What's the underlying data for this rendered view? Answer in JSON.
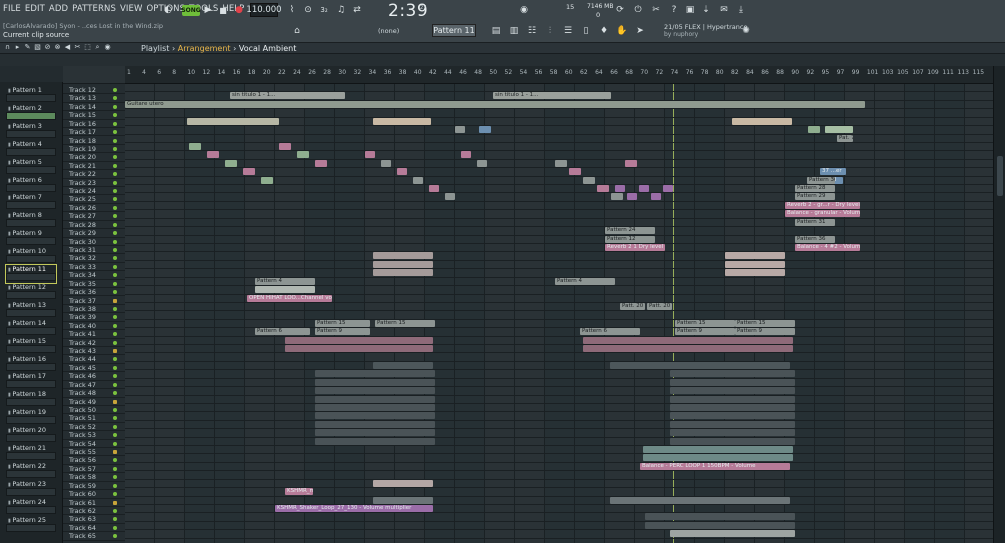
{
  "menu": [
    "FILE",
    "EDIT",
    "ADD",
    "PATTERNS",
    "VIEW",
    "OPTIONS",
    "TOOLS",
    "HELP"
  ],
  "hint": {
    "line1": "[CarlosAlvarado] Syon - ..ces Lost in the Wind.zip",
    "line2": "Current clip source"
  },
  "transport": {
    "mode": "SONG",
    "tempo": "110.000",
    "time": "2:39",
    "time_small": "27",
    "time_unit": "M:S:CS"
  },
  "cpu": {
    "value": "15",
    "memory": "7146 MB",
    "voices": "0"
  },
  "news": {
    "line1": "21/05  FLEX | Hypertrance",
    "line2": "by nuphory"
  },
  "pattern_selector": "Pattern 11",
  "snap": "(none)",
  "playlist": {
    "prefix": "Playlist",
    "sep": "›",
    "section": "Arrangement",
    "sep2": "›",
    "clip": "Vocal Ambient"
  },
  "picker": [
    "Pattern 1",
    "Pattern 2",
    "Pattern 3",
    "Pattern 4",
    "Pattern 5",
    "Pattern 6",
    "Pattern 7",
    "Pattern 8",
    "Pattern 9",
    "Pattern 10",
    "Pattern 11",
    "Pattern 12",
    "Pattern 13",
    "Pattern 14",
    "Pattern 15",
    "Pattern 16",
    "Pattern 17",
    "Pattern 18",
    "Pattern 19",
    "Pattern 20",
    "Pattern 21",
    "Pattern 22",
    "Pattern 23",
    "Pattern 24",
    "Pattern 25"
  ],
  "picker_selected": "Pattern 11",
  "tracks": [
    "Track 12",
    "Track 13",
    "Track 14",
    "Track 15",
    "Track 16",
    "Track 17",
    "Track 18",
    "Track 19",
    "Track 20",
    "Track 21",
    "Track 22",
    "Track 23",
    "Track 24",
    "Track 25",
    "Track 26",
    "Track 27",
    "Track 28",
    "Track 29",
    "Track 30",
    "Track 31",
    "Track 32",
    "Track 33",
    "Track 34",
    "Track 35",
    "Track 36",
    "Track 37",
    "Track 38",
    "Track 39",
    "Track 40",
    "Track 41",
    "Track 42",
    "Track 43",
    "Track 44",
    "Track 45",
    "Track 46",
    "Track 47",
    "Track 48",
    "Track 49",
    "Track 50",
    "Track 51",
    "Track 52",
    "Track 53",
    "Track 54",
    "Track 55",
    "Track 56",
    "Track 57",
    "Track 58",
    "Track 59",
    "Track 60",
    "Track 61",
    "Track 62",
    "Track 63",
    "Track 64",
    "Track 65"
  ],
  "ruler": [
    "1",
    "4",
    "6",
    "8",
    "10",
    "12",
    "14",
    "16",
    "18",
    "20",
    "22",
    "24",
    "26",
    "28",
    "30",
    "32",
    "34",
    "36",
    "38",
    "40",
    "42",
    "44",
    "46",
    "48",
    "50",
    "52",
    "54",
    "56",
    "58",
    "60",
    "62",
    "64",
    "66",
    "68",
    "70",
    "72",
    "74",
    "76",
    "78",
    "80",
    "82",
    "84",
    "86",
    "88",
    "90",
    "92",
    "95",
    "97",
    "99",
    "101",
    "103",
    "105",
    "107",
    "109",
    "111",
    "113",
    "115"
  ],
  "clip_labels": {
    "c1": "sin titulo 1 - 1...",
    "c2": "sin titulo 1 - 1...",
    "c3": "Guitare utero",
    "c4": "Pattern 30",
    "c5": "Pattern 28",
    "c6": "Pattern 29",
    "c7": "Reverb 2 - gr...r - Dry level",
    "c8": "Balance - granular - Volume",
    "c9": "Pattern 31",
    "c10": "Pattern 24",
    "c11": "Pattern 12",
    "c12": "Reverb 2 1 Dry level",
    "c13": "Pattern 36",
    "c14": "Balance - 4 #2 - Volume",
    "c15": "Pattern 4",
    "c16": "OPEN HIHAT LOO...Channel volume",
    "c17": "Pattern 4",
    "c18": "Patt. 20",
    "c19": "Patt. 20",
    "c20": "Pattern 15",
    "c21": "Pattern 15",
    "c22": "Pattern 6",
    "c23": "Pattern 9",
    "c24": "Pattern 15",
    "c25": "Pattern 15",
    "c26": "Pattern 6",
    "c27": "Pattern 9",
    "c28": "Pattern 9",
    "c29": "Balance - PERC LOOP 1 150BPM - Volume",
    "c30": "KSHMR_me",
    "c31": "KSHMR_Shaker_Loop_27_130 - Volume multiplier",
    "c32": "12...ed",
    "c33": "37 ...er",
    "c34": "Pat. 7"
  }
}
